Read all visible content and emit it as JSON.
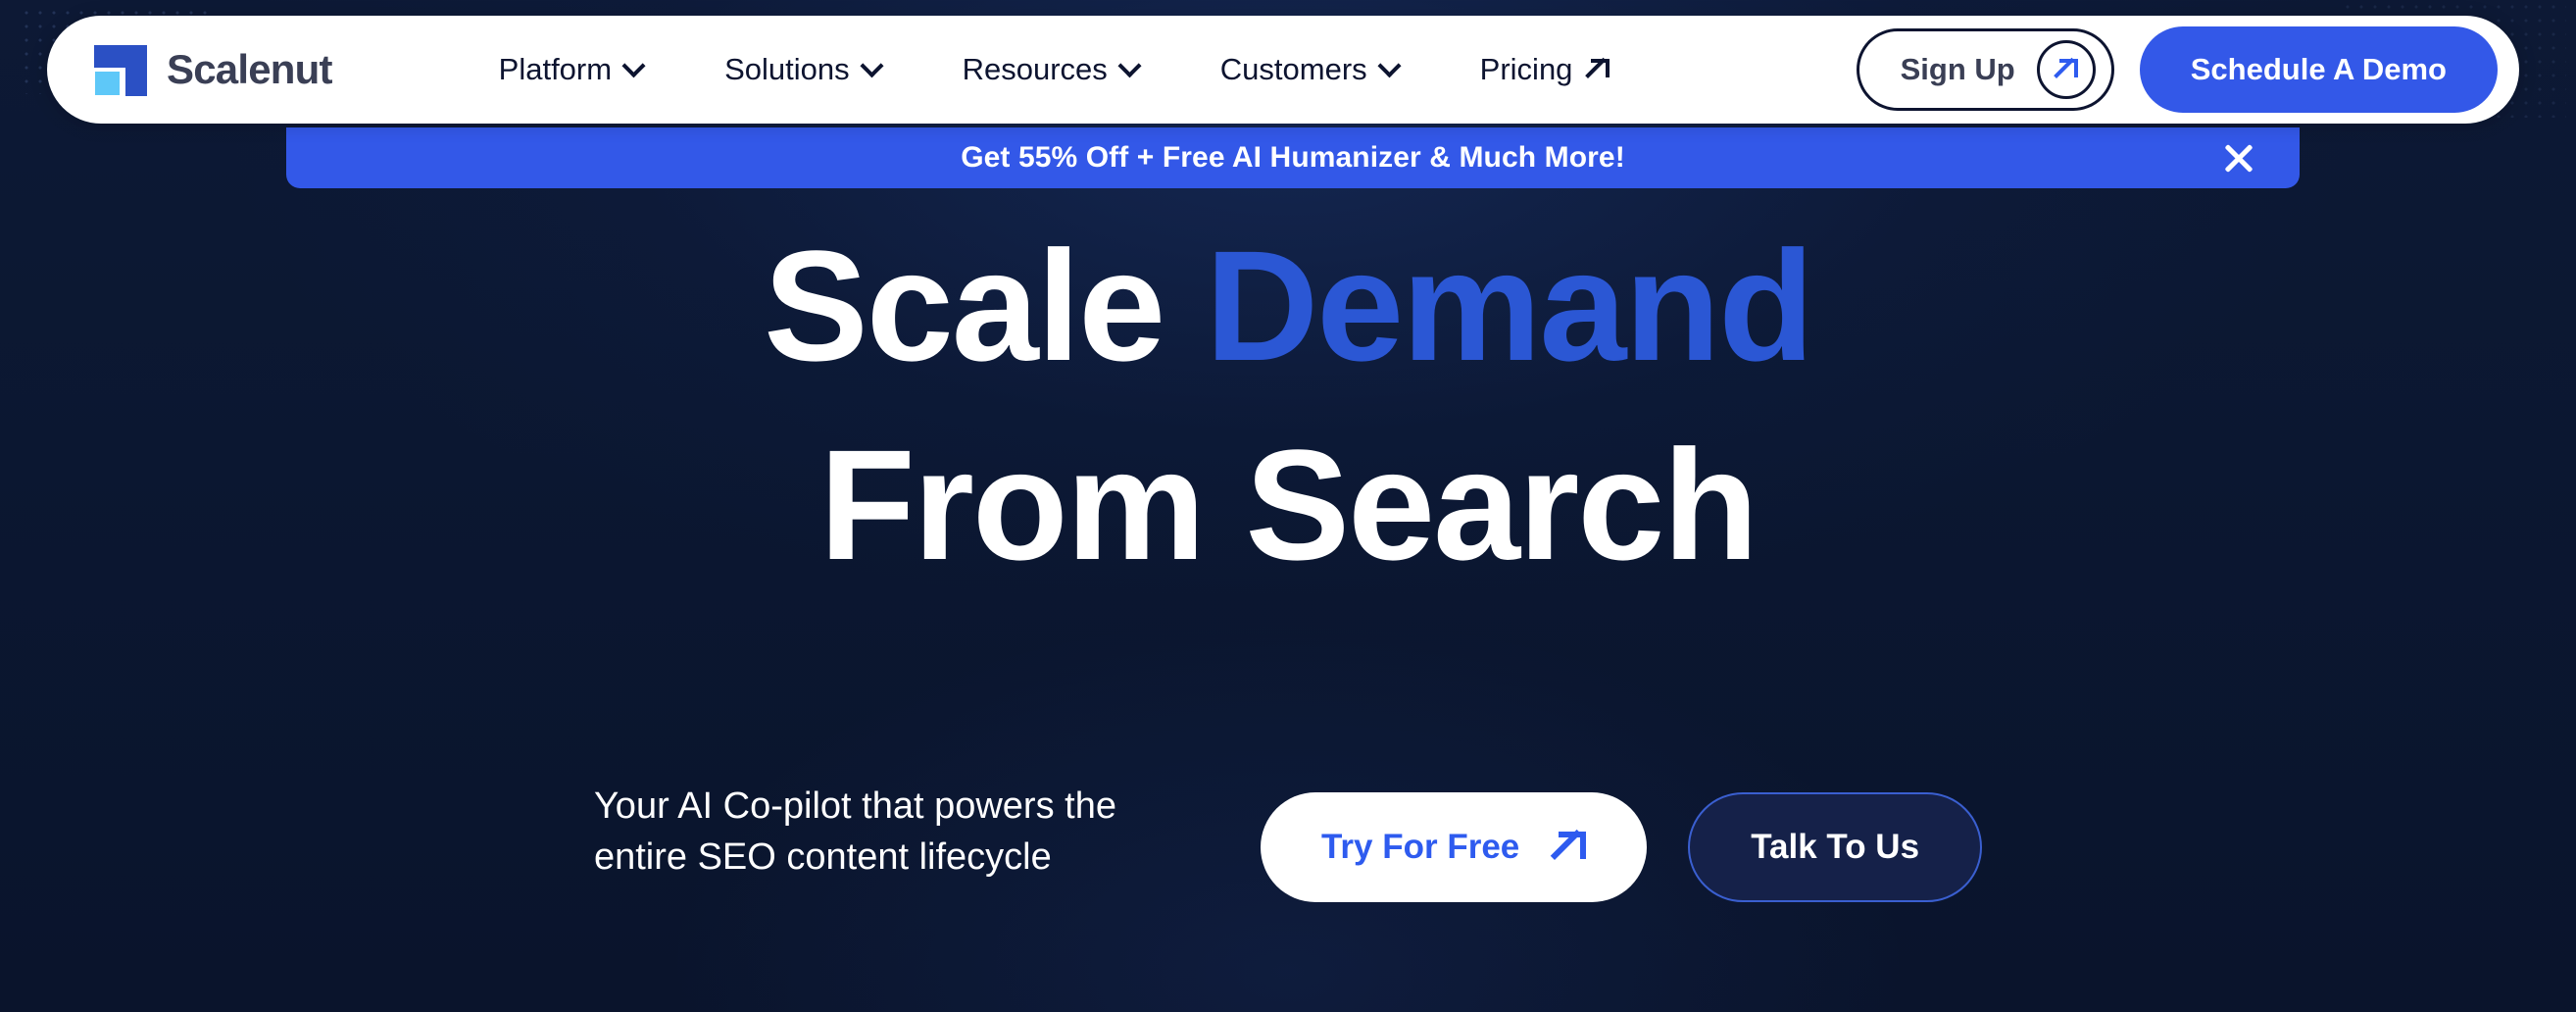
{
  "brand": {
    "name": "Scalenut",
    "logo_icon": "scalenut-logo-icon",
    "logo_primary_color": "#2b50c4",
    "logo_accent_color": "#5ec8f8"
  },
  "theme": {
    "background": "#0b1731",
    "accent_blue": "#3358e8",
    "headline_accent": "#2b57d4",
    "header_surface": "#ffffff"
  },
  "nav": {
    "items": [
      {
        "label": "Platform",
        "icon": "chevron-down-icon"
      },
      {
        "label": "Solutions",
        "icon": "chevron-down-icon"
      },
      {
        "label": "Resources",
        "icon": "chevron-down-icon"
      },
      {
        "label": "Customers",
        "icon": "chevron-down-icon"
      },
      {
        "label": "Pricing",
        "icon": "arrow-up-right-icon"
      }
    ]
  },
  "header_actions": {
    "signup_label": "Sign Up",
    "signup_icon": "arrow-up-right-icon",
    "demo_label": "Schedule A Demo"
  },
  "banner": {
    "text": "Get 55% Off + Free AI Humanizer & Much More!",
    "close_icon": "close-icon",
    "background": "#3358e8"
  },
  "hero": {
    "headline_line1_plain": "Scale ",
    "headline_line1_accent": "Demand",
    "headline_line2": "From Search",
    "subtitle": "Your AI Co-pilot that powers the entire SEO content lifecycle",
    "cta_primary_label": "Try For Free",
    "cta_primary_icon": "arrow-up-right-icon",
    "cta_secondary_label": "Talk To Us"
  }
}
